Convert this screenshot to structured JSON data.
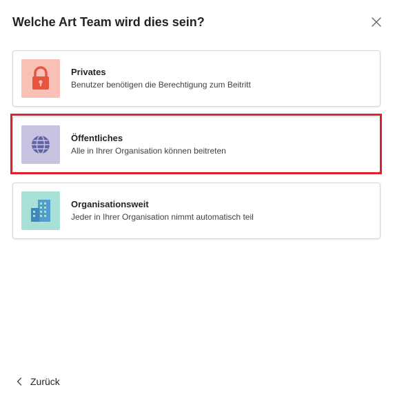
{
  "dialog": {
    "title": "Welche Art Team wird dies sein?"
  },
  "options": [
    {
      "title": "Privates",
      "description": "Benutzer benötigen die Berechtigung zum Beitritt",
      "icon": "lock-icon",
      "tile_color": "#f9c1b5",
      "icon_color": "#e9543f"
    },
    {
      "title": "Öffentliches",
      "description": "Alle in Ihrer Organisation können beitreten",
      "icon": "globe-icon",
      "tile_color": "#c8c3e0",
      "icon_color": "#6264a7",
      "highlighted": true
    },
    {
      "title": "Organisationsweit",
      "description": "Jeder in Ihrer Organisation nimmt automatisch teil",
      "icon": "building-icon",
      "tile_color": "#a9e0d6",
      "icon_color": "#4f9bd4"
    }
  ],
  "footer": {
    "back_label": "Zurück"
  },
  "colors": {
    "highlight_border": "#e0212d"
  }
}
